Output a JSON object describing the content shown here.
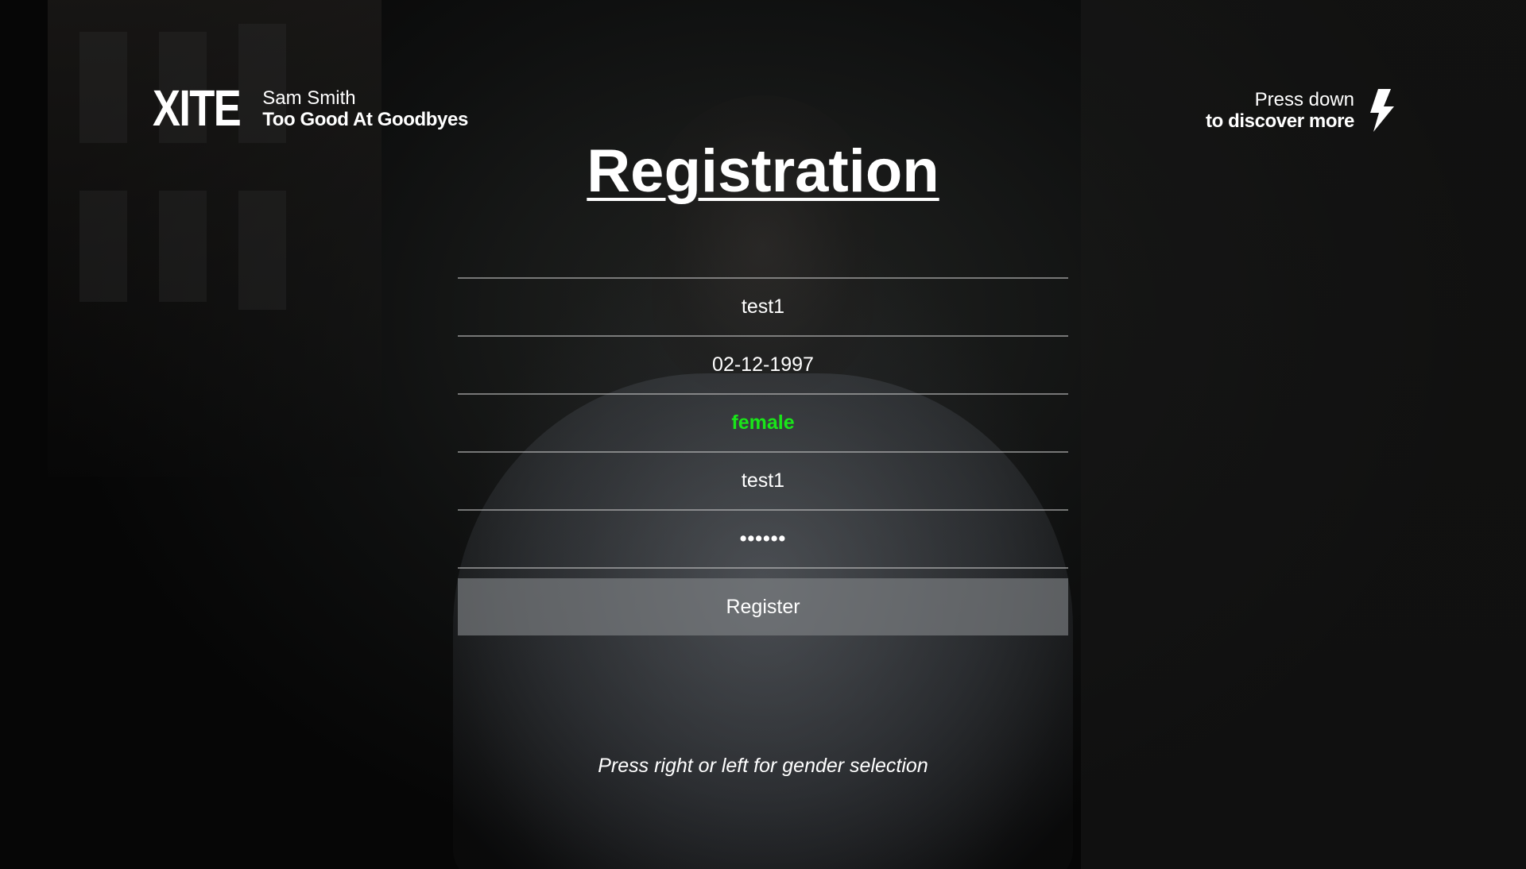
{
  "header": {
    "logo": "XITE",
    "artist": "Sam Smith",
    "song": "Too Good At Goodbyes",
    "hint_line1": "Press down",
    "hint_line2": "to discover more",
    "hint_icon": "lightning-bolt-icon"
  },
  "title": "Registration",
  "form": {
    "fields": [
      {
        "name": "username",
        "value": "test1"
      },
      {
        "name": "birthdate",
        "value": "02-12-1997"
      },
      {
        "name": "gender",
        "value": "female"
      },
      {
        "name": "email",
        "value": "test1"
      },
      {
        "name": "password",
        "value": "••••••"
      }
    ],
    "register_label": "Register"
  },
  "footer": {
    "hint": "Press right or left for gender selection"
  },
  "colors": {
    "selected_option": "#19e619",
    "button_bg": "#808286",
    "text": "#ffffff"
  }
}
